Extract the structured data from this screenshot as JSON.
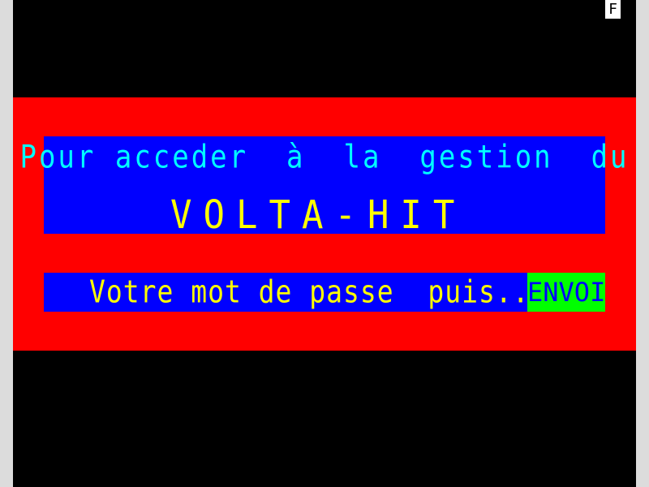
{
  "status_indicator": "F",
  "colors": {
    "background": "#000000",
    "band": "#ff0000",
    "panel": "#0000ff",
    "line1_text": "#00ffff",
    "highlight_text": "#ffff00",
    "envoi_bg": "#00ff00",
    "envoi_text": "#0000ff"
  },
  "header": {
    "line1": "Pour acceder  à  la  gestion  du",
    "line2": "VOLTA-HIT"
  },
  "prompt": {
    "text": "Votre mot de passe  puis...",
    "key_label": "ENVOI"
  }
}
